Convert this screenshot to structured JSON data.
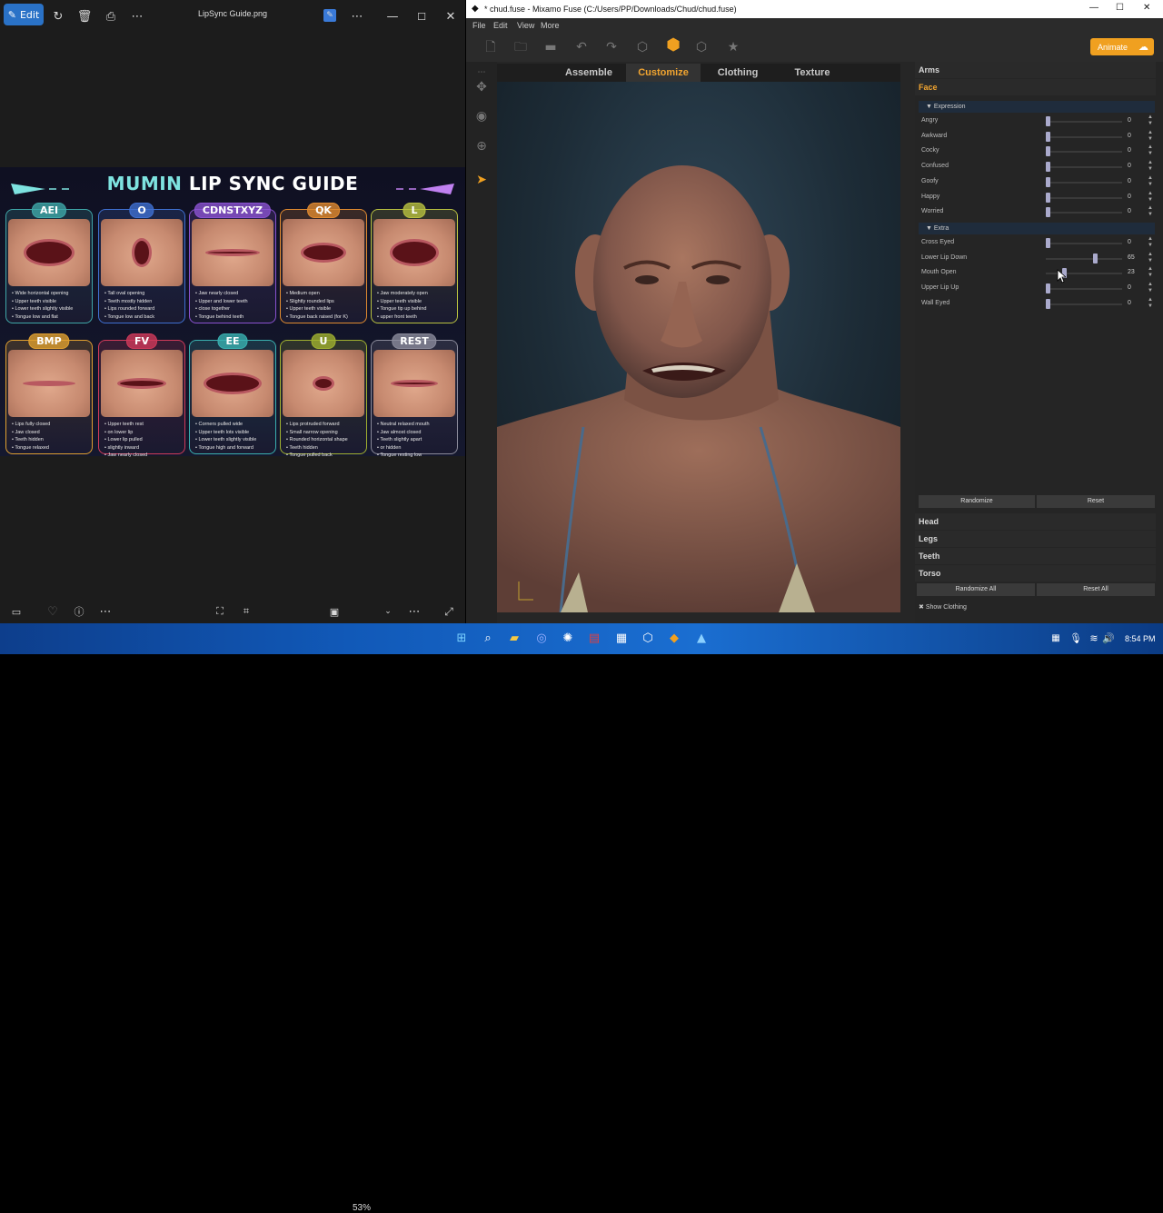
{
  "viewer": {
    "edit_label": "Edit",
    "title": "LipSync Guide.png",
    "zoom": "53%",
    "poster": {
      "title_part1": "MUMIN",
      "title_part2": "LIP SYNC GUIDE",
      "cards": [
        {
          "label": "AEI",
          "color": "#3fa7a8",
          "notes": [
            "Wide horizontal opening",
            "Upper teeth visible",
            "Lower teeth slightly visible",
            "Tongue low and flat"
          ]
        },
        {
          "label": "O",
          "color": "#3f6fd0",
          "notes": [
            "Tall oval opening",
            "Teeth mostly hidden",
            "Lips rounded forward",
            "Tongue low and back"
          ]
        },
        {
          "label": "CDNSTXYZ",
          "color": "#8a52d0",
          "notes": [
            "Jaw nearly closed",
            "Upper and lower teeth",
            "close together",
            "Tongue behind teeth"
          ]
        },
        {
          "label": "QK",
          "color": "#e08a30",
          "notes": [
            "Medium open",
            "Slightly rounded lips",
            "Upper teeth visible",
            "Tongue back raised (for K)"
          ]
        },
        {
          "label": "L",
          "color": "#b8c040",
          "notes": [
            "Jaw moderately open",
            "Upper teeth visible",
            "Tongue tip up behind",
            "upper front teeth"
          ]
        },
        {
          "label": "BMP",
          "color": "#e0a030",
          "notes": [
            "Lips fully closed",
            "Jaw closed",
            "Teeth hidden",
            "Tongue relaxed"
          ]
        },
        {
          "label": "FV",
          "color": "#d03a5a",
          "notes": [
            "Upper teeth rest",
            "on lower lip",
            "Lower lip pulled",
            "slightly inward",
            "Jaw nearly closed"
          ]
        },
        {
          "label": "EE",
          "color": "#3ab0b0",
          "notes": [
            "Corners pulled wide",
            "Upper teeth lots visible",
            "Lower teeth slightly visible",
            "Tongue high and forward"
          ]
        },
        {
          "label": "U",
          "color": "#a0b030",
          "notes": [
            "Lips protruded forward",
            "Small narrow opening",
            "Rounded horizontal shape",
            "Teeth hidden",
            "Tongue pulled back"
          ]
        },
        {
          "label": "REST",
          "color": "#8a8a9a",
          "notes": [
            "Neutral relaxed mouth",
            "Jaw almost closed",
            "Teeth slightly apart",
            "or hidden",
            "Tongue resting low"
          ]
        }
      ]
    }
  },
  "fuse": {
    "window_title": "* chud.fuse - Mixamo Fuse (C:/Users/PP/Downloads/Chud/chud.fuse)",
    "menu": [
      "File",
      "Edit",
      "View",
      "More"
    ],
    "animate_label": "Animate",
    "tabs": [
      "Assemble",
      "Customize",
      "Clothing",
      "Texture"
    ],
    "panel": {
      "arms": "Arms",
      "face": "Face",
      "expression_label": "Expression",
      "expression": [
        {
          "label": "Angry",
          "value": "0",
          "pct": 0
        },
        {
          "label": "Awkward",
          "value": "0",
          "pct": 0
        },
        {
          "label": "Cocky",
          "value": "0",
          "pct": 0
        },
        {
          "label": "Confused",
          "value": "0",
          "pct": 0
        },
        {
          "label": "Goofy",
          "value": "0",
          "pct": 0
        },
        {
          "label": "Happy",
          "value": "0",
          "pct": 0
        },
        {
          "label": "Worried",
          "value": "0",
          "pct": 0
        }
      ],
      "extra_label": "Extra",
      "extra": [
        {
          "label": "Cross Eyed",
          "value": "0",
          "pct": 0
        },
        {
          "label": "Lower Lip Down",
          "value": "65",
          "pct": 0.65
        },
        {
          "label": "Mouth Open",
          "value": "23",
          "pct": 0.23
        },
        {
          "label": "Upper Lip Up",
          "value": "0",
          "pct": 0
        },
        {
          "label": "Wall Eyed",
          "value": "0",
          "pct": 0
        }
      ],
      "randomize": "Randomize",
      "reset": "Reset",
      "head": "Head",
      "legs": "Legs",
      "teeth": "Teeth",
      "torso": "Torso",
      "randomize_all": "Randomize All",
      "reset_all": "Reset All",
      "show_clothing": "Show Clothing"
    }
  },
  "taskbar": {
    "time": "8:54 PM"
  }
}
